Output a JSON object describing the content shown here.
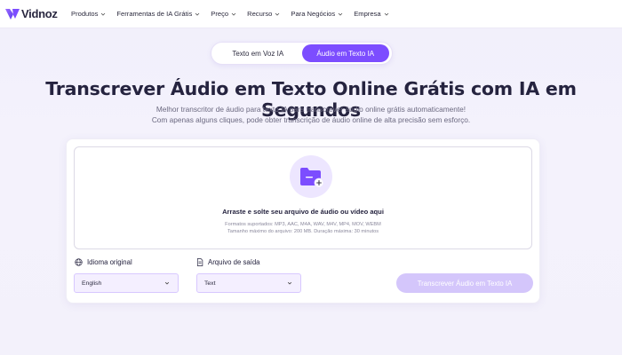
{
  "brand": {
    "name": "Vidnoz",
    "accent": "#7c4dff"
  },
  "nav": {
    "items": [
      {
        "label": "Produtos"
      },
      {
        "label": "Ferramentas de IA Grátis"
      },
      {
        "label": "Preço"
      },
      {
        "label": "Recurso"
      },
      {
        "label": "Para Negócios"
      },
      {
        "label": "Empresa"
      }
    ]
  },
  "toggle": {
    "options": [
      "Texto em Voz IA",
      "Áudio em Texto IA"
    ],
    "active": "Áudio em Texto IA"
  },
  "hero": {
    "title": "Transcrever Áudio em Texto Online Grátis com IA em Segundos",
    "subtitle_1": "Melhor transcritor de áudio para texto IA para transcrever áudio online grátis automaticamente!",
    "subtitle_2": "Com apenas alguns cliques, pode obter transcrição de áudio online de alta precisão sem esforço."
  },
  "upload": {
    "icon": "folder-plus-icon",
    "title": "Arraste e solte seu arquivo de áudio ou vídeo aqui",
    "formats": "Formatos suportados: MP3, AAC, M4A, WAV, M4V, MP4, MOV, WEBM",
    "limits": "Tamanho máximo do arquivo: 200 MB. Duração máxima: 30 minutos"
  },
  "language": {
    "label": "Idioma original",
    "icon": "globe-icon",
    "value": "English"
  },
  "output": {
    "label": "Arquivo de saída",
    "icon": "document-icon",
    "value": "Text"
  },
  "action": {
    "label": "Transcrever Áudio em Texto IA",
    "color": "#d4c6fb"
  }
}
